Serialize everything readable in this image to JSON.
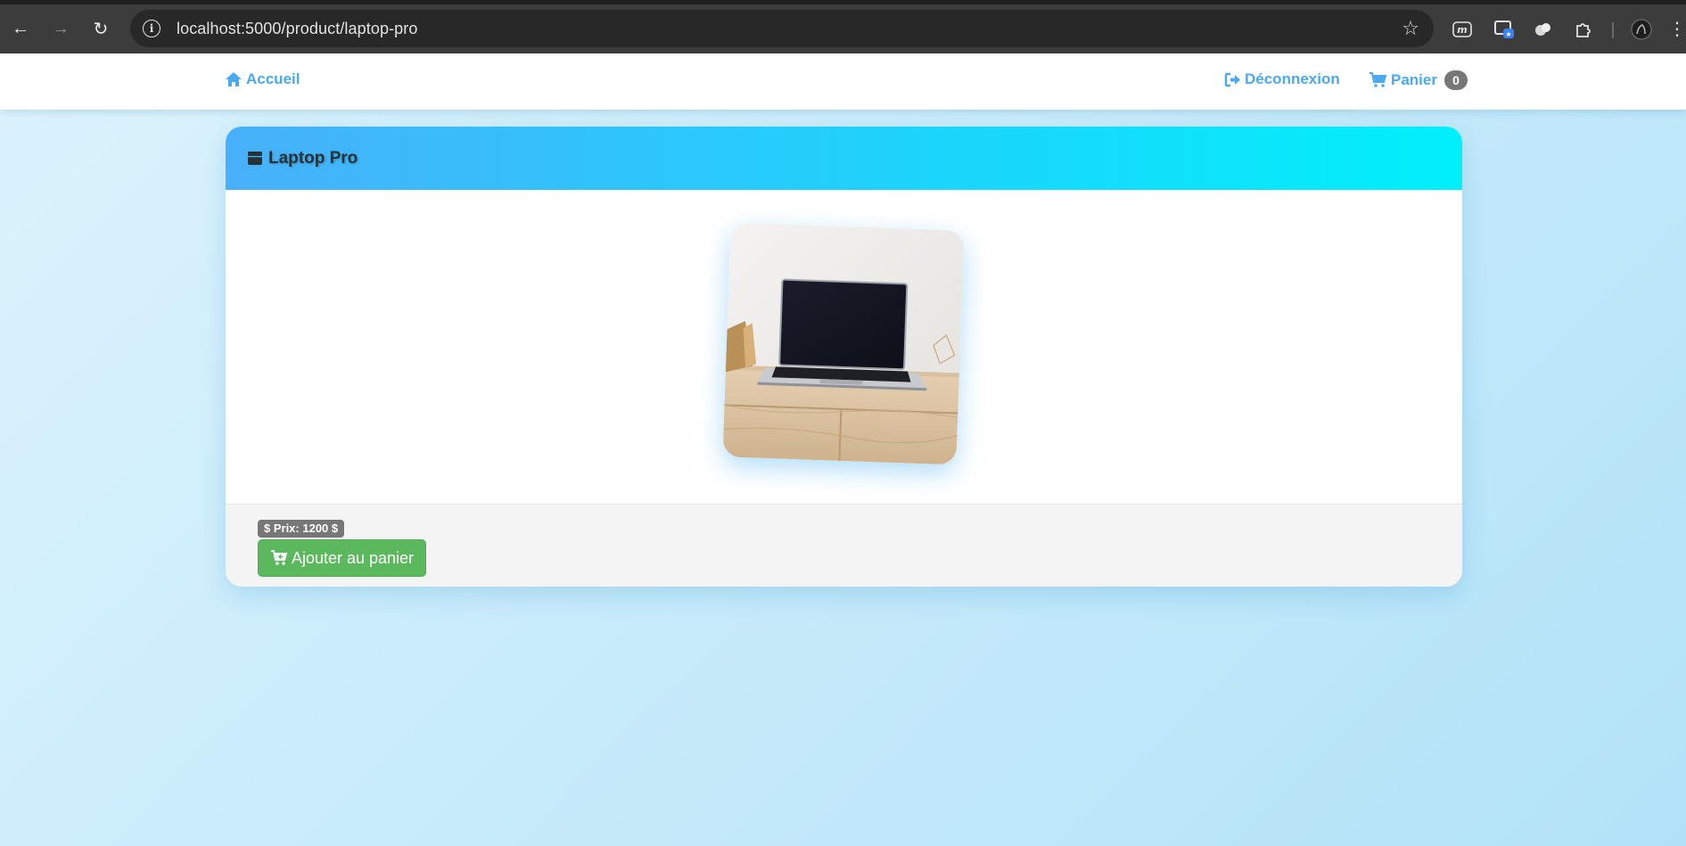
{
  "browser": {
    "url": "localhost:5000/product/laptop-pro",
    "back_icon": "arrow-left-icon",
    "forward_icon": "arrow-right-icon",
    "reload_icon": "reload-icon",
    "bookmark_icon": "star-icon"
  },
  "navbar": {
    "home_label": "Accueil",
    "logout_label": "Déconnexion",
    "cart_label": "Panier",
    "cart_count": "0"
  },
  "product": {
    "title": "Laptop Pro",
    "image_alt": "laptop on wooden desk",
    "price_label": "$ Prix: 1200 $",
    "add_to_cart_label": "Ajouter au panier"
  },
  "colors": {
    "link": "#4aa9f0",
    "header_gradient_start": "#48b0fa",
    "header_gradient_end": "#00f0fb",
    "success": "#5cb85c",
    "badge": "#777777"
  }
}
